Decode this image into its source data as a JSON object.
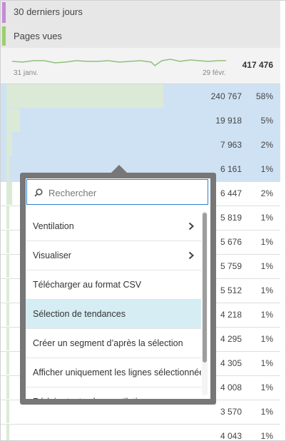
{
  "header": {
    "date_range": "30 derniers jours",
    "metric": "Pages vues",
    "date_colors": [
      "#c58ad8",
      "#9ad06a"
    ]
  },
  "sparkline": {
    "start_label": "31 janv.",
    "end_label": "29 févr.",
    "total": "417 476",
    "line_color": "#8cc27a"
  },
  "rows": [
    {
      "value": "240 767",
      "pct": "58%",
      "bar": 0.58
    },
    {
      "value": "19 918",
      "pct": "5%",
      "bar": 0.05
    },
    {
      "value": "7 963",
      "pct": "2%",
      "bar": 0.02
    },
    {
      "value": "6 161",
      "pct": "1%",
      "bar": 0.01
    },
    {
      "value": "6 447",
      "pct": "2%",
      "bar": 0.02
    },
    {
      "value": "5 819",
      "pct": "1%",
      "bar": 0.01
    },
    {
      "value": "5 676",
      "pct": "1%",
      "bar": 0.01
    },
    {
      "value": "5 759",
      "pct": "1%",
      "bar": 0.01
    },
    {
      "value": "5 512",
      "pct": "1%",
      "bar": 0.01
    },
    {
      "value": "4 218",
      "pct": "1%",
      "bar": 0.01
    },
    {
      "value": "4 295",
      "pct": "1%",
      "bar": 0.01
    },
    {
      "value": "4 305",
      "pct": "1%",
      "bar": 0.01
    },
    {
      "value": "4 008",
      "pct": "1%",
      "bar": 0.01
    },
    {
      "value": "3 570",
      "pct": "1%",
      "bar": 0.01
    },
    {
      "value": "4 043",
      "pct": "1%",
      "bar": 0.01
    }
  ],
  "menu": {
    "search_placeholder": "Rechercher",
    "items": [
      {
        "label": "Ventilation",
        "submenu": true
      },
      {
        "label": "Visualiser",
        "submenu": true
      },
      {
        "label": "Télécharger au format CSV",
        "submenu": false
      },
      {
        "label": "Sélection de tendances",
        "submenu": false,
        "highlighted": true
      },
      {
        "label": "Créer un segment d’après la sélection",
        "submenu": false
      },
      {
        "label": "Afficher uniquement les lignes sélectionnées",
        "submenu": false
      },
      {
        "label": "Réduire toutes les ventilations",
        "submenu": false
      }
    ]
  }
}
